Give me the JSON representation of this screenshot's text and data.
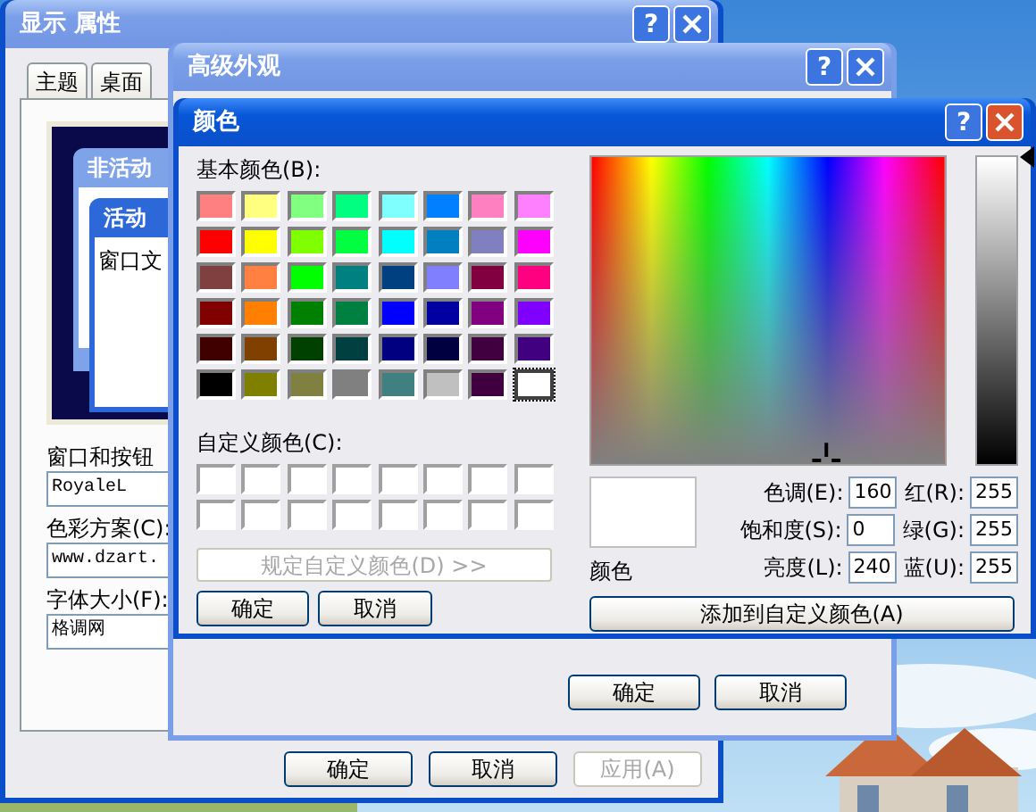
{
  "display_properties": {
    "title": "显示 属性",
    "active": false,
    "help": "?",
    "tabs": [
      {
        "label": "主题",
        "selected": false
      },
      {
        "label": "桌面",
        "selected": false
      }
    ],
    "preview": {
      "inactive_title": "非活动",
      "active_title": "活动",
      "window_text": "窗口文"
    },
    "fields": [
      {
        "label": "窗口和按钮",
        "value": "RoyaleL"
      },
      {
        "label": "色彩方案(C):",
        "value": "www.dzart."
      },
      {
        "label": "字体大小(F):",
        "value": "格调网"
      }
    ],
    "buttons": [
      {
        "label": "确定",
        "disabled": false
      },
      {
        "label": "取消",
        "disabled": false
      },
      {
        "label": "应用(A)",
        "disabled": true
      }
    ]
  },
  "advanced_appearance": {
    "title": "高级外观",
    "active": false,
    "help": "?",
    "buttons": [
      {
        "label": "确定",
        "disabled": false
      },
      {
        "label": "取消",
        "disabled": false
      }
    ]
  },
  "color_dialog": {
    "title": "颜色",
    "active": true,
    "help": "?",
    "basic_label": "基本颜色(B):",
    "basic_colors": [
      {
        "color": "#ff8080",
        "selected": false
      },
      {
        "color": "#ffff80",
        "selected": false
      },
      {
        "color": "#80ff80",
        "selected": false
      },
      {
        "color": "#00ff80",
        "selected": false
      },
      {
        "color": "#80ffff",
        "selected": false
      },
      {
        "color": "#0080ff",
        "selected": false
      },
      {
        "color": "#ff80c0",
        "selected": false
      },
      {
        "color": "#ff80ff",
        "selected": false
      },
      {
        "color": "#ff0000",
        "selected": false
      },
      {
        "color": "#ffff00",
        "selected": false
      },
      {
        "color": "#80ff00",
        "selected": false
      },
      {
        "color": "#00ff40",
        "selected": false
      },
      {
        "color": "#00ffff",
        "selected": false
      },
      {
        "color": "#0080c0",
        "selected": false
      },
      {
        "color": "#8080c0",
        "selected": false
      },
      {
        "color": "#ff00ff",
        "selected": false
      },
      {
        "color": "#804040",
        "selected": false
      },
      {
        "color": "#ff8040",
        "selected": false
      },
      {
        "color": "#00ff00",
        "selected": false
      },
      {
        "color": "#008080",
        "selected": false
      },
      {
        "color": "#004080",
        "selected": false
      },
      {
        "color": "#8080ff",
        "selected": false
      },
      {
        "color": "#800040",
        "selected": false
      },
      {
        "color": "#ff0080",
        "selected": false
      },
      {
        "color": "#800000",
        "selected": false
      },
      {
        "color": "#ff8000",
        "selected": false
      },
      {
        "color": "#008000",
        "selected": false
      },
      {
        "color": "#008040",
        "selected": false
      },
      {
        "color": "#0000ff",
        "selected": false
      },
      {
        "color": "#0000a0",
        "selected": false
      },
      {
        "color": "#800080",
        "selected": false
      },
      {
        "color": "#8000ff",
        "selected": false
      },
      {
        "color": "#400000",
        "selected": false
      },
      {
        "color": "#804000",
        "selected": false
      },
      {
        "color": "#004000",
        "selected": false
      },
      {
        "color": "#004040",
        "selected": false
      },
      {
        "color": "#000080",
        "selected": false
      },
      {
        "color": "#000040",
        "selected": false
      },
      {
        "color": "#400040",
        "selected": false
      },
      {
        "color": "#400080",
        "selected": false
      },
      {
        "color": "#000000",
        "selected": false
      },
      {
        "color": "#808000",
        "selected": false
      },
      {
        "color": "#808040",
        "selected": false
      },
      {
        "color": "#808080",
        "selected": false
      },
      {
        "color": "#408080",
        "selected": false
      },
      {
        "color": "#c0c0c0",
        "selected": false
      },
      {
        "color": "#400040",
        "selected": false
      },
      {
        "color": "#ffffff",
        "selected": true
      }
    ],
    "custom_label": "自定义颜色(C):",
    "custom_colors": [
      {
        "color": "#ffffff"
      },
      {
        "color": "#ffffff"
      },
      {
        "color": "#ffffff"
      },
      {
        "color": "#ffffff"
      },
      {
        "color": "#ffffff"
      },
      {
        "color": "#ffffff"
      },
      {
        "color": "#ffffff"
      },
      {
        "color": "#ffffff"
      },
      {
        "color": "#ffffff"
      },
      {
        "color": "#ffffff"
      },
      {
        "color": "#ffffff"
      },
      {
        "color": "#ffffff"
      },
      {
        "color": "#ffffff"
      },
      {
        "color": "#ffffff"
      },
      {
        "color": "#ffffff"
      },
      {
        "color": "#ffffff"
      }
    ],
    "define_button": {
      "label": "规定自定义颜色(D) >>",
      "disabled": true
    },
    "ok": "确定",
    "cancel": "取消",
    "luminance": {
      "level": 1
    },
    "current_color": {
      "color": "#ffffff",
      "label": "颜色"
    },
    "values": [
      {
        "label": "色调(E):",
        "value": "160",
        "rgb_label": "红(R):",
        "rgb_value": "255"
      },
      {
        "label": "饱和度(S):",
        "value": "0",
        "rgb_label": "绿(G):",
        "rgb_value": "255"
      },
      {
        "label": "亮度(L):",
        "value": "240",
        "rgb_label": "蓝(U):",
        "rgb_value": "255"
      }
    ],
    "add_button": "添加到自定义颜色(A)"
  }
}
